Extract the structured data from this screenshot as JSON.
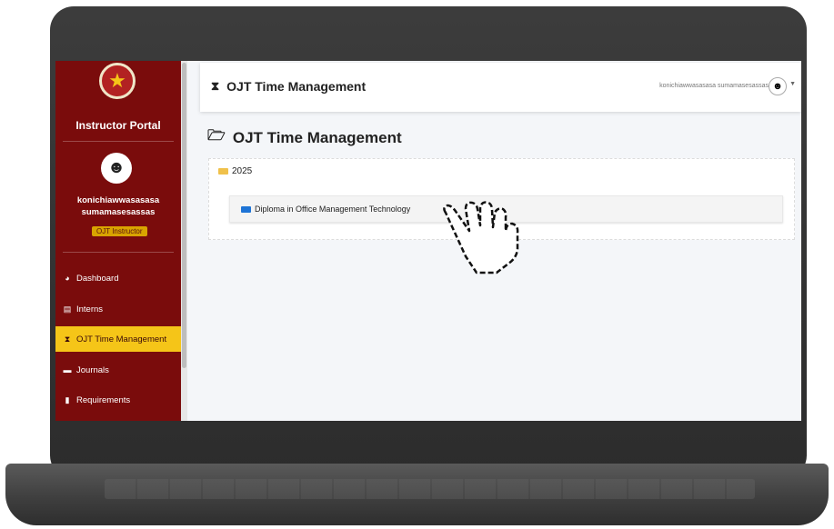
{
  "sidebar": {
    "portal_title": "Instructor Portal",
    "user_name_line1": "konichiawwasasasa",
    "user_name_line2": "sumamasesassas",
    "role": "OJT Instructor",
    "items": [
      {
        "label": "Dashboard",
        "icon": "tachometer-icon"
      },
      {
        "label": "Interns",
        "icon": "id-card-icon"
      },
      {
        "label": "OJT Time Management",
        "icon": "hourglass-icon",
        "active": true
      },
      {
        "label": "Journals",
        "icon": "book-icon"
      },
      {
        "label": "Requirements",
        "icon": "file-icon"
      }
    ]
  },
  "topbar": {
    "title": "OJT Time Management",
    "user": "konichiawwasasasa sumamasesassas"
  },
  "main": {
    "title": "OJT Time Management",
    "year": "2025",
    "program": "Diploma in Office Management Technology"
  },
  "colors": {
    "sidebar_bg": "#7a0c0c",
    "accent": "#f5c518",
    "folder_yellow": "#f0c14b",
    "folder_blue": "#1e74d6"
  }
}
